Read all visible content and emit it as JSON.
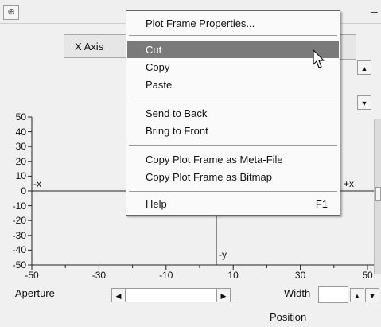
{
  "window": {
    "corner_icon": "pin-icon",
    "corner_glyph": "⊕",
    "right_glyph": "–"
  },
  "tab": {
    "label": "X Axis"
  },
  "scroll": {
    "up_glyph": "▲",
    "down_glyph": "▼"
  },
  "plot": {
    "y_ticks": [
      "50",
      "40",
      "30",
      "20",
      "10",
      "0",
      "-10",
      "-20",
      "-30",
      "-40",
      "-50"
    ],
    "x_ticks": [
      "-50",
      "-30",
      "-10",
      "10",
      "30",
      "50"
    ],
    "axis_labels": {
      "neg_x": "-x",
      "pos_x": "+x",
      "neg_y": "-y"
    }
  },
  "controls": {
    "aperture_label": "Aperture",
    "left_glyph": "◀",
    "right_glyph": "▶",
    "width_label": "Width",
    "width_value": "",
    "position_label": "Position"
  },
  "context_menu": {
    "items": [
      {
        "label": "Plot Frame Properties..."
      },
      {
        "label": "Cut",
        "highlighted": true
      },
      {
        "label": "Copy"
      },
      {
        "label": "Paste"
      },
      {
        "label": "Send to Back"
      },
      {
        "label": "Bring to Front"
      },
      {
        "label": "Copy Plot Frame as Meta-File"
      },
      {
        "label": "Copy Plot Frame as Bitmap"
      },
      {
        "label": "Help",
        "shortcut": "F1"
      }
    ]
  },
  "colors": {
    "highlight": "#7a7a7a",
    "background": "#f0f0f0",
    "menu": "#fafafa"
  }
}
